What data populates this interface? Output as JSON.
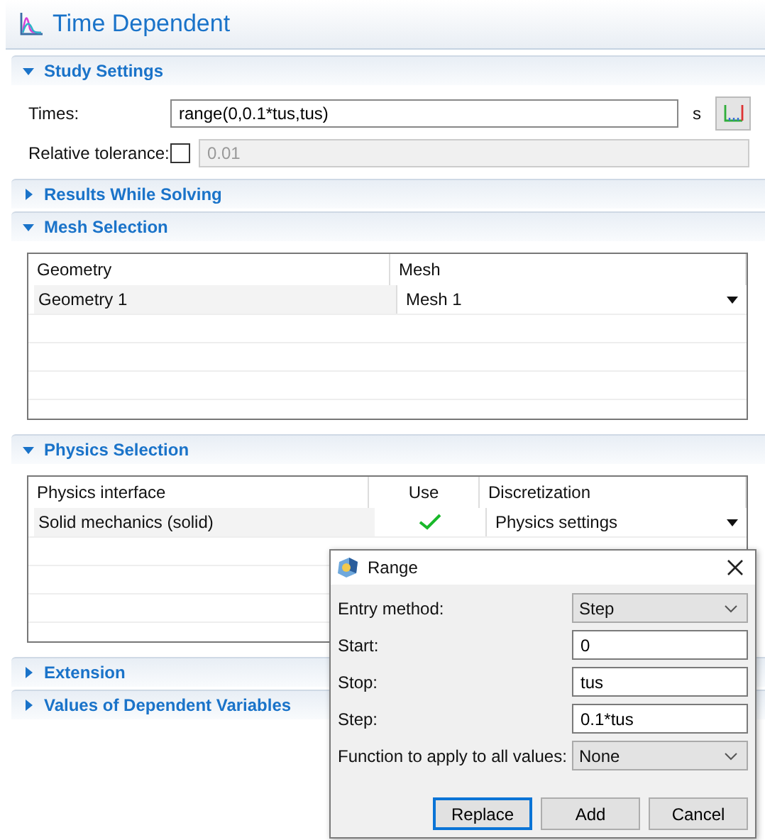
{
  "title": "Time Dependent",
  "sections": [
    {
      "kind": "study",
      "title": "Study Settings",
      "expanded": true,
      "times": {
        "label": "Times:",
        "value": "range(0,0.1*tus,tus)",
        "unit": "s"
      },
      "tolerance": {
        "label": "Relative tolerance:",
        "checked": false,
        "value": "0.01"
      }
    },
    {
      "title": "Results While Solving",
      "expanded": false
    },
    {
      "kind": "table",
      "title": "Mesh Selection",
      "expanded": true,
      "columns": [
        {
          "label": "Geometry",
          "kind": "text"
        },
        {
          "label": "Mesh",
          "kind": "dropdown"
        }
      ],
      "rows": [
        {
          "cells": [
            "Geometry 1",
            "Mesh 1"
          ]
        }
      ]
    },
    {
      "kind": "table",
      "title": "Physics Selection",
      "expanded": true,
      "columns": [
        {
          "label": "Physics interface",
          "kind": "text"
        },
        {
          "label": "Use",
          "kind": "check"
        },
        {
          "label": "Discretization",
          "kind": "dropdown"
        }
      ],
      "rows": [
        {
          "cells": [
            "Solid mechanics (solid)",
            true,
            "Physics settings"
          ]
        }
      ]
    },
    {
      "title": "Extension",
      "expanded": false
    },
    {
      "title": "Values of Dependent Variables",
      "expanded": false
    }
  ],
  "dialog": {
    "title": "Range",
    "fields": [
      {
        "label": "Entry method:",
        "kind": "select",
        "value": "Step"
      },
      {
        "label": "Start:",
        "kind": "input",
        "value": "0"
      },
      {
        "label": "Stop:",
        "kind": "input",
        "value": "tus"
      },
      {
        "label": "Step:",
        "kind": "input",
        "value": "0.1*tus"
      },
      {
        "label": "Function to apply to all values:",
        "kind": "select",
        "value": "None"
      }
    ],
    "buttons": [
      {
        "label": "Replace",
        "default": true
      },
      {
        "label": "Add",
        "default": false
      },
      {
        "label": "Cancel",
        "default": false
      }
    ]
  }
}
